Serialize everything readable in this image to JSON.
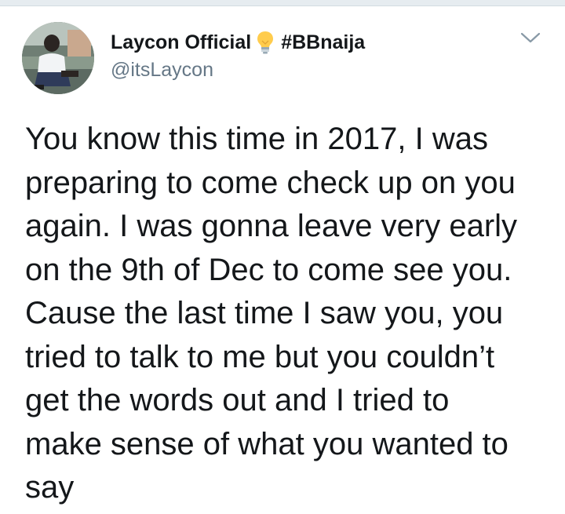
{
  "tweet": {
    "author": {
      "display_name": "Laycon Official",
      "emoji_icon": "light-bulb-icon",
      "hashtag": "#BBnaija",
      "handle": "@itsLaycon"
    },
    "menu_icon": "chevron-down-icon",
    "text": "You know this time in 2017, I was\npreparing to come check up on you\nagain. I was gonna leave very early\non the 9th of Dec to come see you.\nCause the last time I saw you, you\ntried to talk to me but you couldn’t\nget the words out and I tried to\nmake sense of what you wanted to\nsay"
  },
  "colors": {
    "text_primary": "#14171a",
    "text_secondary": "#657786",
    "divider": "#e6ecf0"
  }
}
